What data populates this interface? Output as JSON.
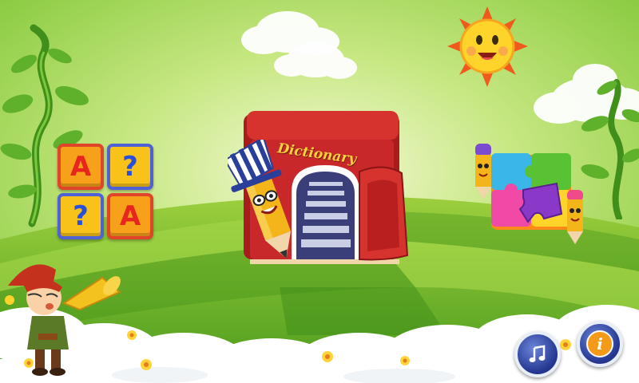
{
  "game": {
    "dictionary_label": "Dictionary",
    "letter_tiles": [
      "A",
      "?",
      "?",
      "A"
    ]
  },
  "icons": {
    "music": "music-note-icon",
    "info": "info-icon"
  },
  "colors": {
    "sky": "#8ed24a",
    "meadow_light": "#8cc43a",
    "meadow_dark": "#3f8f18",
    "book_red": "#c8282a",
    "button_blue": "#2e44a8"
  }
}
